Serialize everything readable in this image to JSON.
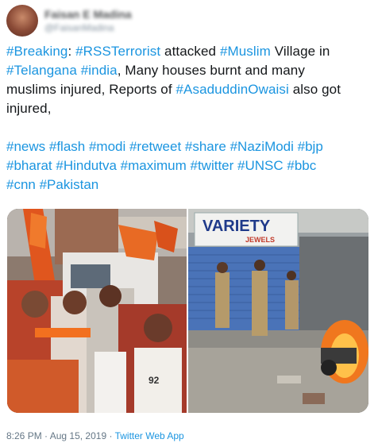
{
  "user": {
    "display_name": "Faisan E Madina",
    "handle": "@FaisanMadina"
  },
  "tweet": {
    "lines": [
      [
        {
          "text": "#Breaking",
          "tag": true
        },
        {
          "text": ":  ",
          "tag": false
        },
        {
          "text": "#RSSTerrorist",
          "tag": true
        },
        {
          "text": "  attacked ",
          "tag": false
        },
        {
          "text": "#Muslim",
          "tag": true
        },
        {
          "text": " Village in",
          "tag": false
        }
      ],
      [
        {
          "text": "#Telangana",
          "tag": true
        },
        {
          "text": " ",
          "tag": false
        },
        {
          "text": "#india",
          "tag": true
        },
        {
          "text": ", Many houses burnt and many",
          "tag": false
        }
      ],
      [
        {
          "text": "muslims injured, Reports of ",
          "tag": false
        },
        {
          "text": "#AsaduddinOwaisi",
          "tag": true
        },
        {
          "text": " also got",
          "tag": false
        }
      ],
      [
        {
          "text": "injured,",
          "tag": false
        }
      ]
    ],
    "hashtag_lines": [
      "#news #flash #modi #retweet #share  #NaziModi #bjp",
      "#bharat #Hindutva #maximum #twitter  #UNSC #bbc",
      "#cnn #Pakistan"
    ]
  },
  "media": {
    "left_image": "crowd-with-saffron-flags-photo",
    "right_image": "police-near-burning-motorcycle-photo",
    "shop_sign_main": "VARIETY",
    "shop_sign_sub": "JEWELS",
    "jersey_number": "92"
  },
  "meta": {
    "time": "8:26 PM",
    "separator": " · ",
    "date": "Aug 15, 2019",
    "source": "Twitter Web App"
  },
  "colors": {
    "link": "#1b95e0",
    "text": "#14171a",
    "muted": "#657786"
  }
}
